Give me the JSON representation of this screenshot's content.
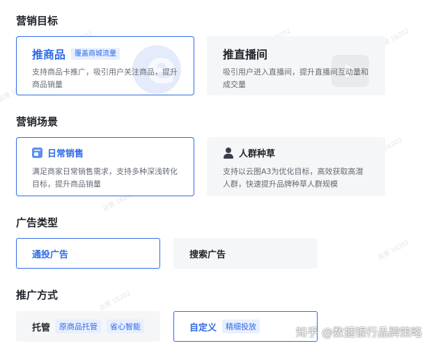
{
  "sections": {
    "goal_title": "营销目标",
    "scene_title": "营销场景",
    "ad_type_title": "广告类型",
    "promo_title": "推广方式"
  },
  "goals": [
    {
      "title": "推商品",
      "tag": "覆盖商城流量",
      "desc": "支持商品卡推广，吸引用户关注商品，提升商品销量",
      "selected": true,
      "icon": "e-shop-icon"
    },
    {
      "title": "推直播间",
      "tag": "",
      "desc": "吸引用户进入直播间，提升直播间互动量和成交量",
      "selected": false,
      "icon": "play-icon"
    }
  ],
  "scenes": [
    {
      "title": "日常销售",
      "desc": "满足商家日常销售需求，支持多种深浅转化目标，提升商品销量",
      "selected": true,
      "icon": "calendar-icon"
    },
    {
      "title": "人群种草",
      "desc": "支持以云图A3为优化目标，高效获取高潜人群，快速提升品牌种草人群规模",
      "selected": false,
      "icon": "person-icon"
    }
  ],
  "ad_types": [
    {
      "label": "通投广告",
      "selected": true
    },
    {
      "label": "搜索广告",
      "selected": false
    }
  ],
  "promo": [
    {
      "label": "托管",
      "tags": [
        "原商品托管",
        "省心智能"
      ],
      "selected": false
    },
    {
      "label": "自定义",
      "tags": [
        "精细投放"
      ],
      "selected": true
    }
  ],
  "watermarks": [
    "运营 16202",
    "运营 16202",
    "运营 16202",
    "运营 16202",
    "运营 16202",
    "运营 16202",
    "运营 16202",
    "运营 16202"
  ],
  "footer_watermark": "知乎 @数据银行品牌策略",
  "colors": {
    "accent": "#2e6be6",
    "tag_bg": "#e8efff",
    "card_bg": "#f5f6f7"
  }
}
